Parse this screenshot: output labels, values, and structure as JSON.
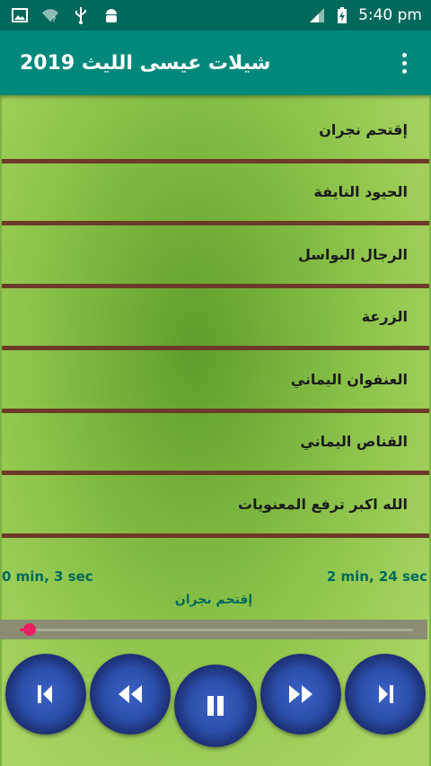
{
  "status_bar": {
    "time": "5:40 pm",
    "icons": [
      "image-icon",
      "wifi-unknown-icon",
      "usb-icon",
      "android-icon",
      "signal-icon",
      "battery-charging-icon"
    ]
  },
  "app_bar": {
    "title": "شيلات عيسى الليث 2019",
    "menu_icon": "more-vert-icon"
  },
  "playlist": {
    "items": [
      {
        "label": "إقتحم نجران"
      },
      {
        "label": "الحيود النايفة"
      },
      {
        "label": "الرجال البواسل"
      },
      {
        "label": "الزرعة"
      },
      {
        "label": "العنفوان اليماني"
      },
      {
        "label": "القناص اليماني"
      },
      {
        "label": "الله اكبر ترفع المعنويات"
      }
    ]
  },
  "player": {
    "elapsed": "0 min, 3 sec",
    "duration": "2 min, 24 sec",
    "now_playing": "إقتحم نجران",
    "progress_fraction": 0.02,
    "accent_color": "#e91e63",
    "controls": [
      "previous-icon",
      "rewind-icon",
      "pause-icon",
      "fast-forward-icon",
      "next-icon"
    ]
  }
}
